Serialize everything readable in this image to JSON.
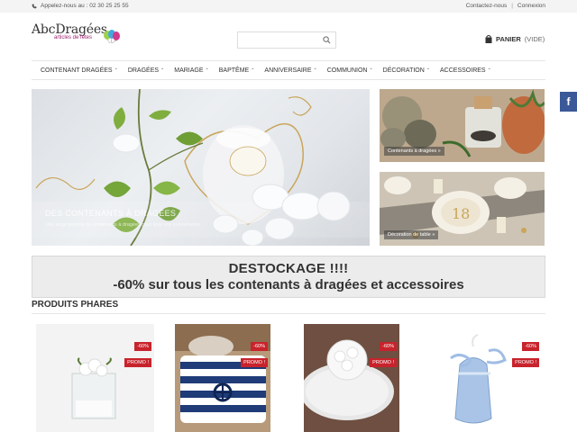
{
  "topbar": {
    "phone": "Appelez-nous au : 02 30 25 25 55",
    "contact": "Contactez-nous",
    "separator": "|",
    "login": "Connexion"
  },
  "header": {
    "logo_name": "AbcDragées",
    "logo_tagline": "articles de fêtes",
    "search_placeholder": "",
    "cart_label": "PANIER",
    "cart_count": "(VIDE)"
  },
  "nav": {
    "items": [
      {
        "label": "CONTENANT DRAGÉES"
      },
      {
        "label": "DRAGÉES"
      },
      {
        "label": "MARIAGE"
      },
      {
        "label": "BAPTÊME"
      },
      {
        "label": "ANNIVERSAIRE"
      },
      {
        "label": "COMMUNION"
      },
      {
        "label": "DÉCORATION"
      },
      {
        "label": "ACCESSOIRES"
      }
    ]
  },
  "banners": {
    "hero_caption": "DES CONTENANTS À DRAGÉES",
    "hero_subcaption": "Une large gamme de contenants à dragées pour tous vos événements",
    "side1_caption": "Contenants à dragées »",
    "side2_caption": "Décoration de table »"
  },
  "promo": {
    "line1": "DESTOCKAGE !!!!",
    "line2": "-60% sur tous les contenants à dragées et accessoires"
  },
  "section": {
    "title": "PRODUITS PHARES"
  },
  "products": [
    {
      "discount": "-60%",
      "promo": "PROMO !"
    },
    {
      "discount": "-60%",
      "promo": "PROMO !"
    },
    {
      "discount": "-60%",
      "promo": "PROMO !"
    },
    {
      "discount": "-60%",
      "promo": "PROMO !"
    }
  ],
  "social": {
    "facebook": "f"
  },
  "colors": {
    "accent_red": "#c8232c",
    "facebook_blue": "#3b5998",
    "logo_purple": "#a01e6e"
  }
}
